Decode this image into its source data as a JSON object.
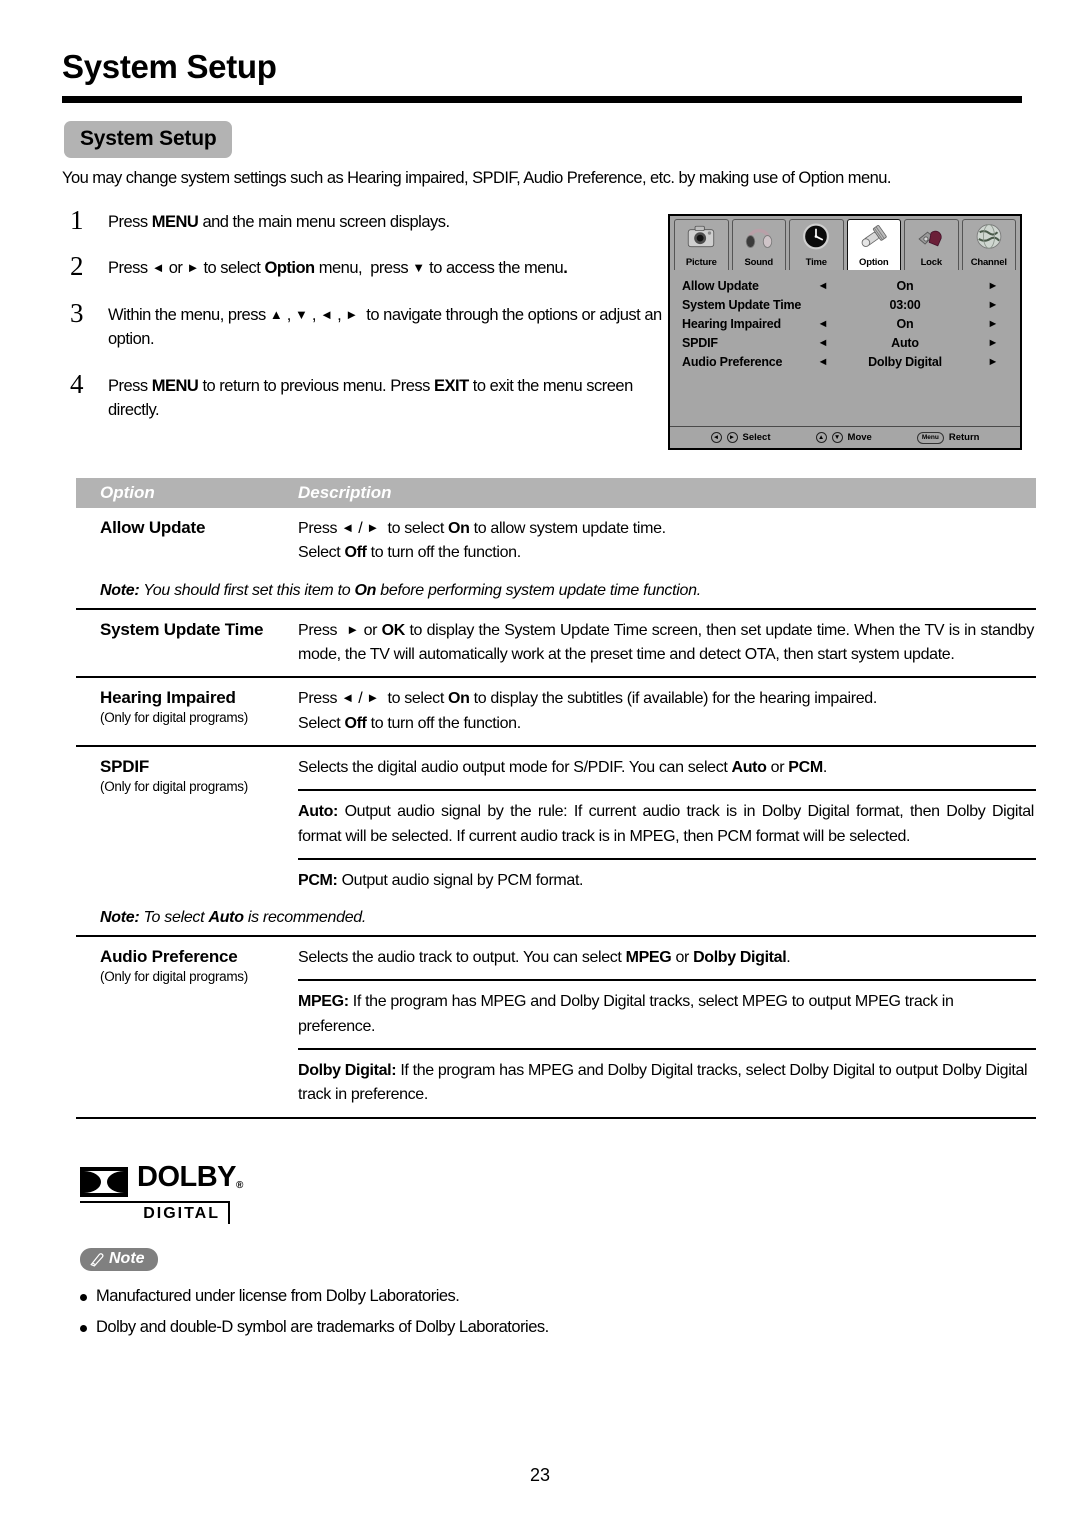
{
  "header": {
    "title": "System Setup",
    "section_badge": "System Setup",
    "intro": "You may change system settings such as Hearing impaired, SPDIF, Audio Preference, etc. by making use of Option menu."
  },
  "steps": [
    {
      "num": "1",
      "html": "Press <b>MENU</b> and the main menu screen displays."
    },
    {
      "num": "2",
      "html": "Press <span class=\"ar\">◄</span> or <span class=\"ar\">►</span> to select <b>Option</b> menu,&nbsp; press <span class=\"ar\">▼</span> to access the menu<b>.</b>"
    },
    {
      "num": "3",
      "html": "Within the menu, press <span class=\"ar\">▲</span> , <span class=\"ar\">▼</span> , <span class=\"ar\">◄</span> , <span class=\"ar\">►</span>&nbsp; to navigate through the options or adjust an option."
    },
    {
      "num": "4",
      "html": "Press <b>MENU</b> to return to previous menu. Press <b>EXIT</b> to exit the menu screen directly."
    }
  ],
  "osd": {
    "tabs": [
      {
        "label": "Picture",
        "icon": "camera-icon",
        "active": false
      },
      {
        "label": "Sound",
        "icon": "headphones-icon",
        "active": false
      },
      {
        "label": "Time",
        "icon": "clock-icon",
        "active": false
      },
      {
        "label": "Option",
        "icon": "gear-tool-icon",
        "active": true
      },
      {
        "label": "Lock",
        "icon": "padlock-icon",
        "active": false
      },
      {
        "label": "Channel",
        "icon": "globe-icon",
        "active": false
      }
    ],
    "rows": [
      {
        "label": "Allow Update",
        "left_arrow": "◄",
        "value": "On",
        "right_arrow": "►"
      },
      {
        "label": "System Update Time",
        "left_arrow": "",
        "value": "03:00",
        "right_arrow": "►"
      },
      {
        "label": "Hearing Impaired",
        "left_arrow": "◄",
        "value": "On",
        "right_arrow": "►"
      },
      {
        "label": "SPDIF",
        "left_arrow": "◄",
        "value": "Auto",
        "right_arrow": "►"
      },
      {
        "label": "Audio Preference",
        "left_arrow": "◄",
        "value": "Dolby Digital",
        "right_arrow": "►"
      }
    ],
    "footer": {
      "select_keys": "◄►",
      "select_label": "Select",
      "move_keys": "▲▼",
      "move_label": "Move",
      "menu_key": "Menu",
      "return_label": "Return"
    },
    "colors": {
      "panel_bg": "#a6a6a6",
      "active_tab_bg": "#ffffff"
    }
  },
  "table": {
    "headers": {
      "option": "Option",
      "description": "Description"
    },
    "rows": [
      {
        "option": "Allow Update",
        "sub": "",
        "blocks": [
          "Press <span class=\"ar\">◄</span> / <span class=\"ar\">►</span>&nbsp; to select <b>On</b> to allow system update time.<br>Select <b>Off</b> to turn off the function."
        ],
        "note": "<b>Note:</b> You should first set this item to <b>On</b> before performing system update time function."
      },
      {
        "option": "System Update Time",
        "sub": "",
        "blocks": [
          "Press&nbsp; <span class=\"ar\">►</span> or <b>OK</b> to display the System Update Time screen, then set update time. When the TV is in standby mode, the TV will automatically work at the preset time and detect OTA, then start system update."
        ],
        "note": ""
      },
      {
        "option": "Hearing Impaired",
        "sub": "(Only for digital programs)",
        "blocks": [
          "Press <span class=\"ar\">◄</span> / <span class=\"ar\">►</span>&nbsp; to select <b>On</b> to display the subtitles (if available) for the hearing impaired.<br>Select <b>Off</b> to turn off the function."
        ],
        "note": ""
      },
      {
        "option": "SPDIF",
        "sub": "(Only for digital programs)",
        "blocks": [
          "Selects the digital audio output mode for S/PDIF. You can select <b>Auto</b> or <b>PCM</b>.",
          "<b>Auto:</b> Output audio signal by the rule: If current audio track is in Dolby Digital format, then Dolby Digital format will be selected. If current audio track is in MPEG, then PCM format will be selected.",
          "<b>PCM:</b> Output audio signal by PCM format."
        ],
        "note": "<b>Note:</b> To select <b>Auto</b> is recommended."
      },
      {
        "option": "Audio Preference",
        "sub": "(Only for digital programs)",
        "blocks": [
          "Selects the audio track to output. You can select <b>MPEG</b> or <b>Dolby Digital</b>.",
          "<b>MPEG:</b> If the program has MPEG and Dolby Digital tracks, select MPEG to output MPEG track in preference.",
          "<b>Dolby Digital:</b> If the program has MPEG and Dolby Digital tracks, select Dolby Digital to output Dolby Digital track in preference."
        ],
        "note": ""
      }
    ]
  },
  "dolby": {
    "word": "DOLBY",
    "registered": "®",
    "sub": "DIGITAL"
  },
  "note_block": {
    "badge": "Note",
    "items": [
      "Manufactured under license from Dolby Laboratories.",
      "Dolby and double-D symbol are trademarks of Dolby Laboratories."
    ]
  },
  "page_number": "23"
}
